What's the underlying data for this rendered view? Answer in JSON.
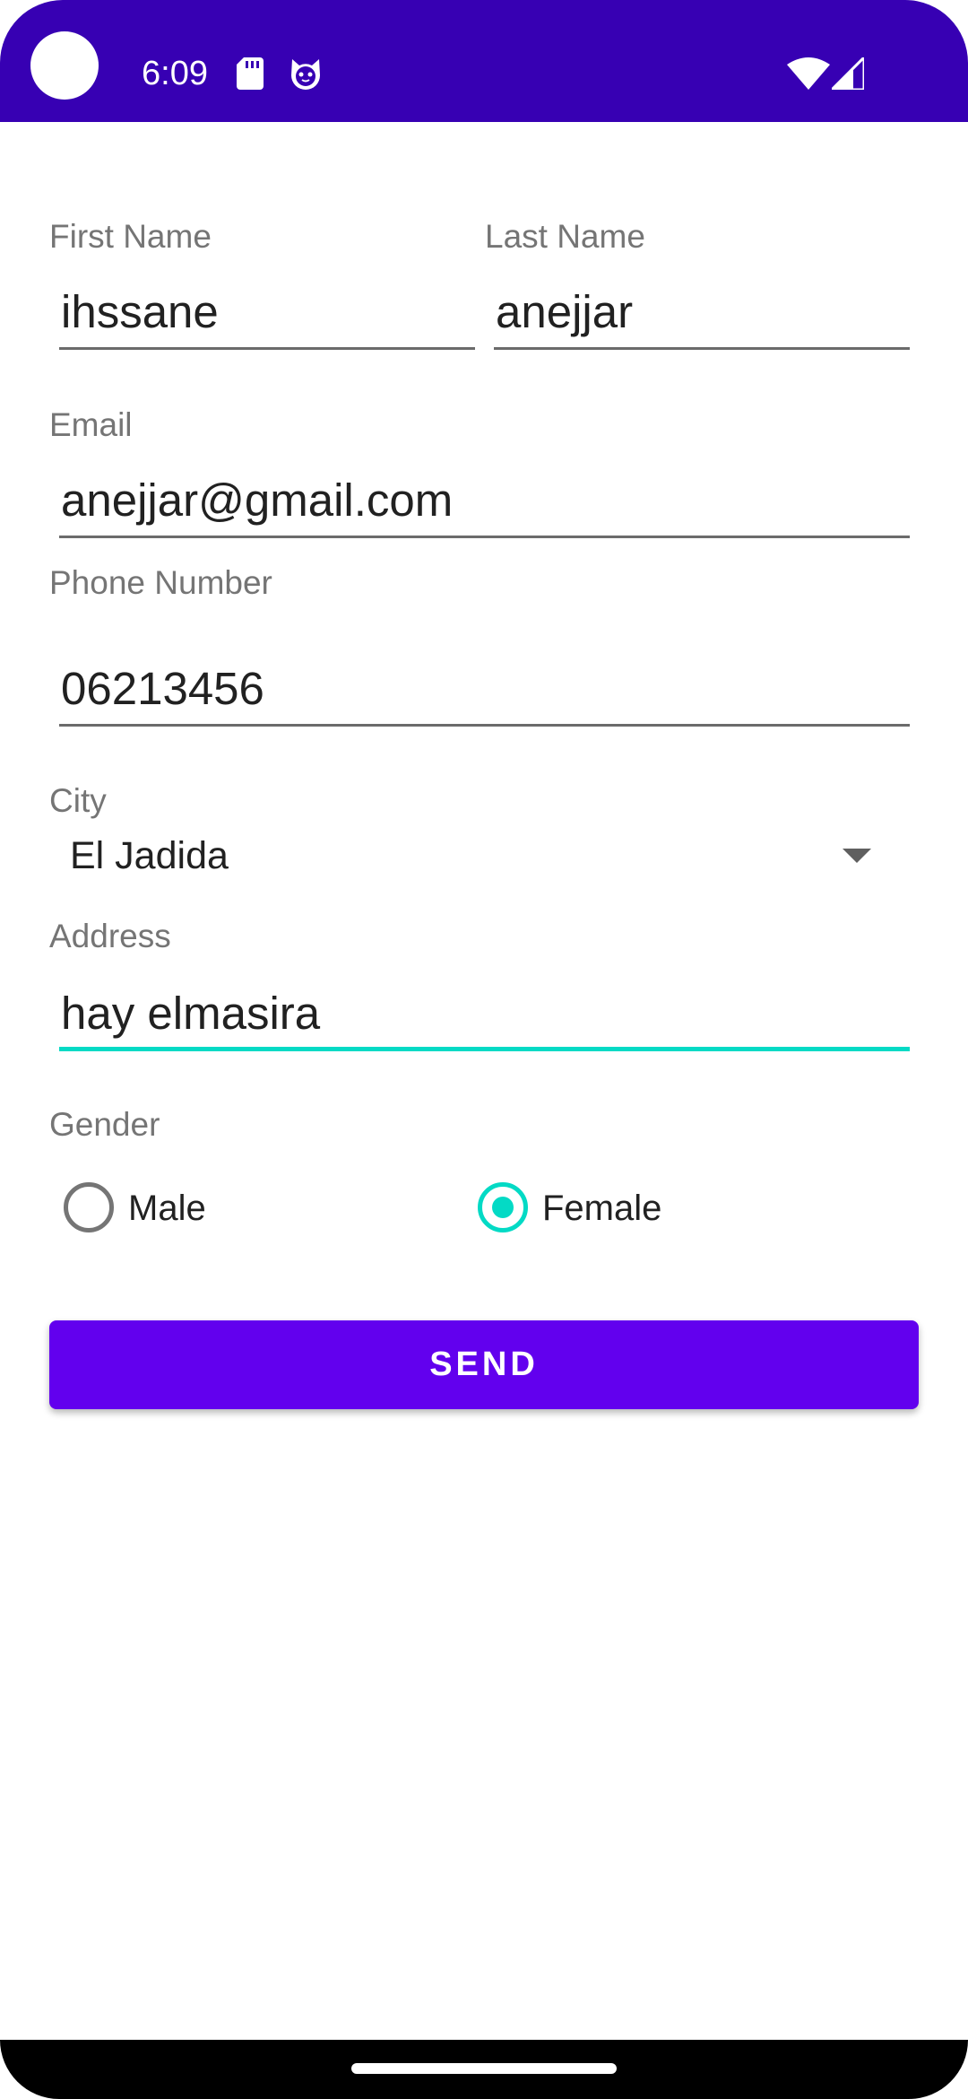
{
  "colors": {
    "status_bar": "#3700b3",
    "primary": "#6200ee",
    "accent": "#03dac5"
  },
  "status_bar": {
    "time": "6:09",
    "icons": [
      "sd-card-icon",
      "android-cat-icon",
      "wifi-icon",
      "cell-signal-icon"
    ]
  },
  "form": {
    "first_name": {
      "label": "First Name",
      "value": "ihssane"
    },
    "last_name": {
      "label": "Last Name",
      "value": "anejjar"
    },
    "email": {
      "label": "Email",
      "value": "anejjar@gmail.com"
    },
    "phone": {
      "label": "Phone Number",
      "value": "06213456"
    },
    "city": {
      "label": "City",
      "selected": "El Jadida"
    },
    "address": {
      "label": "Address",
      "value": "hay elmasira"
    },
    "gender": {
      "label": "Gender",
      "options": [
        {
          "label": "Male",
          "checked": false
        },
        {
          "label": "Female",
          "checked": true
        }
      ]
    },
    "send_label": "SEND"
  }
}
